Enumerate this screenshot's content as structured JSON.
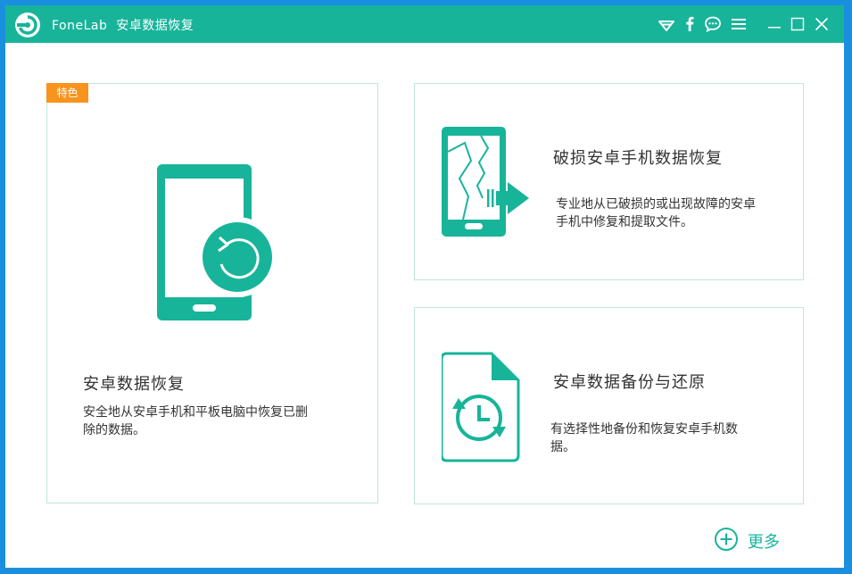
{
  "app": {
    "brand": "FoneLab",
    "title": "安卓数据恢复"
  },
  "titlebar_icons": [
    "wifi-icon",
    "facebook-icon",
    "chat-icon",
    "menu-icon",
    "minimize-icon",
    "maximize-icon",
    "close-icon"
  ],
  "cards": {
    "main": {
      "badge": "特色",
      "title": "安卓数据恢复",
      "desc_line1": "安全地从安卓手机和平板电脑中恢复已删",
      "desc_line2": "除的数据。"
    },
    "broken": {
      "title": "破损安卓手机数据恢复",
      "desc_line1": "专业地从已破损的或出现故障的安卓",
      "desc_line2": "手机中修复和提取文件。"
    },
    "backup": {
      "title": "安卓数据备份与还原",
      "desc_line1": "有选择性地备份和恢复安卓手机数",
      "desc_line2": "据。"
    }
  },
  "more": {
    "label": "更多"
  },
  "colors": {
    "accent": "#18b49a",
    "badge": "#f7941d",
    "desktop": "#1a8fe0"
  }
}
